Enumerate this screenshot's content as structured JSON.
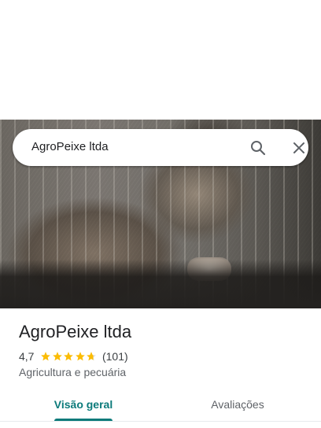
{
  "search": {
    "query": "AgroPeixe ltda",
    "icons": [
      "search-icon",
      "close-icon"
    ]
  },
  "place": {
    "name": "AgroPeixe ltda",
    "rating": "4,7",
    "rating_value": 4.7,
    "review_count": "(101)",
    "category": "Agricultura e pecuária"
  },
  "tabs": [
    {
      "label": "Visão geral",
      "selected": true
    },
    {
      "label": "Avaliações",
      "selected": false
    }
  ],
  "colors": {
    "accent": "#0b7a7a",
    "star": "#fbbc04",
    "text_primary": "#202124",
    "text_secondary": "#5f6368"
  }
}
